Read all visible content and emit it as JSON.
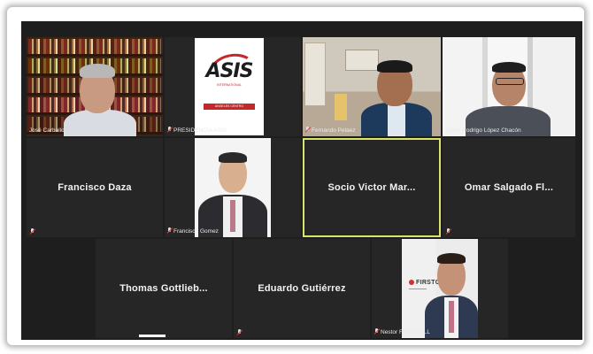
{
  "participants": [
    {
      "tile": "tile-1",
      "label": "José Carballo",
      "type": "video",
      "muted": false
    },
    {
      "tile": "tile-2",
      "label": "PRESIDENCIA ASIS",
      "type": "logo",
      "muted": true
    },
    {
      "tile": "tile-3",
      "label": "Fernando Pelaez",
      "type": "video",
      "muted": true
    },
    {
      "tile": "tile-4",
      "label": "Javier Rodrigo López Chacón",
      "type": "video",
      "muted": false
    },
    {
      "tile": "tile-5",
      "name": "Francisco Daza",
      "type": "name-only",
      "muted": true
    },
    {
      "tile": "tile-6",
      "label": "Francisco Gomez",
      "type": "photo",
      "muted": true
    },
    {
      "tile": "tile-7",
      "name": "Socio Victor Mar...",
      "type": "name-only",
      "muted": false,
      "active_speaker": true
    },
    {
      "tile": "tile-8",
      "name": "Omar Salgado Fl...",
      "type": "name-only",
      "muted": true
    },
    {
      "tile": "tile-9",
      "name": "Thomas Gottlieb...",
      "type": "name-only",
      "muted": false
    },
    {
      "tile": "tile-10",
      "name": "Eduardo Gutiérrez",
      "type": "name-only",
      "muted": true
    },
    {
      "tile": "tile-11",
      "label": "Nestor FIRSTCALL",
      "type": "photo",
      "muted": true
    }
  ],
  "logo": {
    "name": "ASIS",
    "subtitle": "INTERNATIONAL",
    "tagline": "ANGELES CENTRO METROPOLITANO"
  },
  "firstcall_logo": "FIRSTCALL",
  "colors": {
    "background": "#1e1e1e",
    "tile": "#262626",
    "active_speaker_border": "#d8e46a",
    "mute_red": "#e53935",
    "asis_red": "#c62828"
  }
}
